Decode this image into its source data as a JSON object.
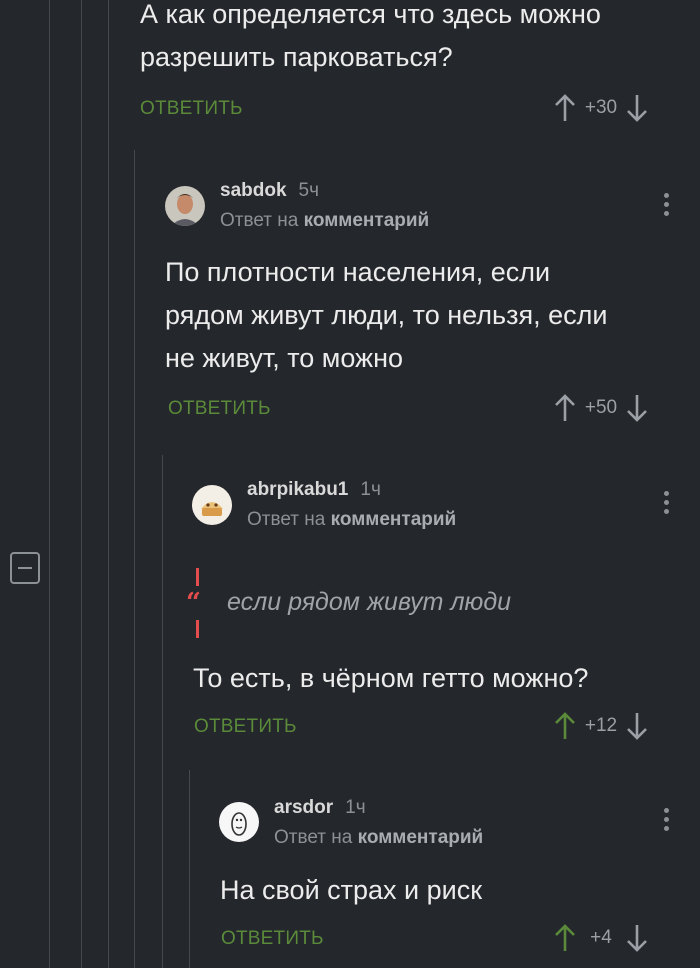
{
  "thread": {
    "collapse_icon": "minus-square-icon",
    "comments": [
      {
        "text_lines": [
          "А как определяется что здесь можно",
          "разрешить парковаться?"
        ],
        "reply_label": "ОТВЕТИТЬ",
        "score": "+30",
        "upvoted": false
      },
      {
        "author": "sabdok",
        "time": "5ч",
        "reply_to_prefix": "Ответ на",
        "reply_to_link": "комментарий",
        "text_lines": [
          "По плотности населения, если",
          "рядом живут люди, то нельзя, если",
          "не живут, то можно"
        ],
        "reply_label": "ОТВЕТИТЬ",
        "score": "+50",
        "upvoted": false
      },
      {
        "author": "abrpikabu1",
        "time": "1ч",
        "reply_to_prefix": "Ответ на",
        "reply_to_link": "комментарий",
        "quote": "если рядом живут люди",
        "text_lines": [
          "То есть, в чёрном гетто можно?"
        ],
        "reply_label": "ОТВЕТИТЬ",
        "score": "+12",
        "upvoted": true
      },
      {
        "author": "arsdor",
        "time": "1ч",
        "reply_to_prefix": "Ответ на",
        "reply_to_link": "комментарий",
        "text_lines": [
          "На свой страх и риск"
        ],
        "reply_label": "ОТВЕТИТЬ",
        "score": "+4",
        "upvoted": true
      }
    ]
  },
  "colors": {
    "background": "#24272b",
    "reply_green": "#5a8a3a",
    "upvote_active": "#5a8a3a",
    "quote_red": "#e34d4d"
  }
}
